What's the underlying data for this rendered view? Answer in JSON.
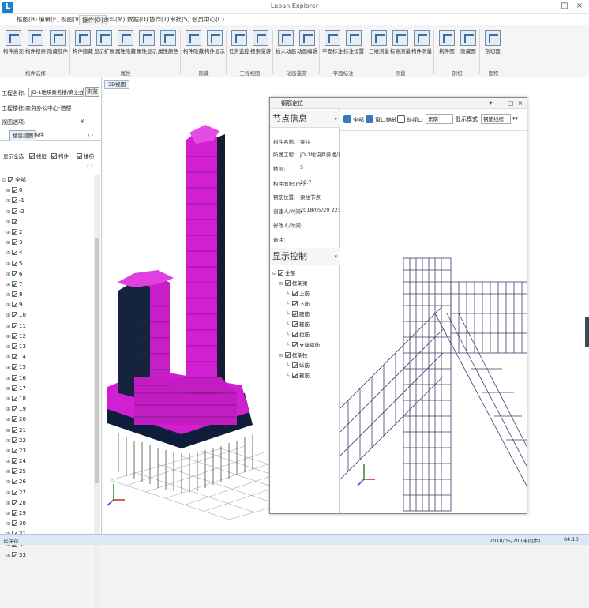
{
  "window": {
    "app_logo": "L",
    "title": "Luban Explorer",
    "controls": [
      "–",
      "□",
      "×"
    ]
  },
  "menu": [
    {
      "label": "框图(B)",
      "active": false
    },
    {
      "label": "编辑(E)",
      "active": false
    },
    {
      "label": "视图(V)",
      "active": false
    },
    {
      "label": "操作(O)",
      "active": true
    },
    {
      "label": "资料(M)",
      "active": false
    },
    {
      "label": "数据(D)",
      "active": false
    },
    {
      "label": "协作(T)",
      "active": false
    },
    {
      "label": "审批(S)",
      "active": false
    },
    {
      "label": "会员中心(C)",
      "active": false
    }
  ],
  "ribbon": {
    "buttons": [
      "构件高亮",
      "构件搜索",
      "隐藏部件",
      "构件隐藏",
      "显示扩展",
      "属性隐藏",
      "属性显示",
      "属性颜色",
      "构件隐藏",
      "构件显示",
      "任务监控",
      "搜索漫游",
      "插入动画",
      "动画编辑",
      "平面标注",
      "标注设置",
      "三维测量",
      "标高测量",
      "构件测量",
      "构件图",
      "隐藏图",
      "剖切面"
    ],
    "groups": [
      "构件选择",
      "属性",
      "隐藏",
      "工程视图",
      "动画漫游",
      "平面标注",
      "测量",
      "剖切",
      "面积"
    ]
  },
  "left_panel": {
    "project_label": "工程名称:",
    "project_value": "JD-1地块商务楼/商业办公中心",
    "browse_button": "浏览",
    "building_label": "工程楼栋:",
    "building_value": "商务办公中心-塔楼",
    "view_label": "视图选项:",
    "tabs": [
      "楼层视图",
      "构件"
    ],
    "filters": [
      "显示全选",
      "楼层",
      "构件",
      "楼梯"
    ],
    "tree": {
      "root": "全部",
      "floors": [
        "0",
        "-1",
        "-2",
        "1",
        "2",
        "3",
        "4",
        "5",
        "6",
        "7",
        "8",
        "9",
        "10",
        "11",
        "12",
        "13",
        "14",
        "15",
        "16",
        "17",
        "18",
        "19",
        "20",
        "21",
        "22",
        "23",
        "24",
        "25",
        "26",
        "27",
        "28",
        "29",
        "30",
        "31",
        "32",
        "33"
      ]
    }
  },
  "doc_tab": "3D视图",
  "dialog": {
    "title": "钢筋定位",
    "info_header": "节点信息",
    "info_rows": [
      {
        "label": "构件名称:",
        "value": "梁柱"
      },
      {
        "label": "所属工程:",
        "value": "JD-1地块商务楼/商业办公"
      },
      {
        "label": "楼层:",
        "value": "5"
      },
      {
        "label": "构件面积(m²):",
        "value": "28.7"
      },
      {
        "label": "钢筋位置:",
        "value": "梁柱节点"
      },
      {
        "label": "创建人/时间:",
        "value": "2018/05/20 22:05"
      },
      {
        "label": "修改人/时间:",
        "value": ""
      },
      {
        "label": "备注:",
        "value": ""
      }
    ],
    "control_header": "显示控制",
    "control_tree": [
      {
        "label": "全部",
        "level": 0
      },
      {
        "label": "框架梁",
        "level": 1
      },
      {
        "label": "上筋",
        "level": 2
      },
      {
        "label": "下筋",
        "level": 2
      },
      {
        "label": "腰筋",
        "level": 2
      },
      {
        "label": "箍筋",
        "level": 2
      },
      {
        "label": "拉筋",
        "level": 2
      },
      {
        "label": "支座钢筋",
        "level": 2
      },
      {
        "label": "框架柱",
        "level": 1
      },
      {
        "label": "纵筋",
        "level": 2
      },
      {
        "label": "箍筋",
        "level": 2
      }
    ],
    "toolbar": {
      "zoom_fit": "全部",
      "window_zoom": "窗口缩放",
      "bind_label": "前视口",
      "view_select": "东南",
      "mode_label": "显示模式",
      "mode_select": "钢筋线框"
    }
  },
  "statusbar": {
    "left": "已保存",
    "mid": "2018/05/20 (未同步)",
    "right": "84:10"
  },
  "colors": {
    "building": "#d21fd2",
    "frame": "#1b1f33",
    "rebar": "#3a3f6a",
    "accent": "#1e7fd0"
  }
}
